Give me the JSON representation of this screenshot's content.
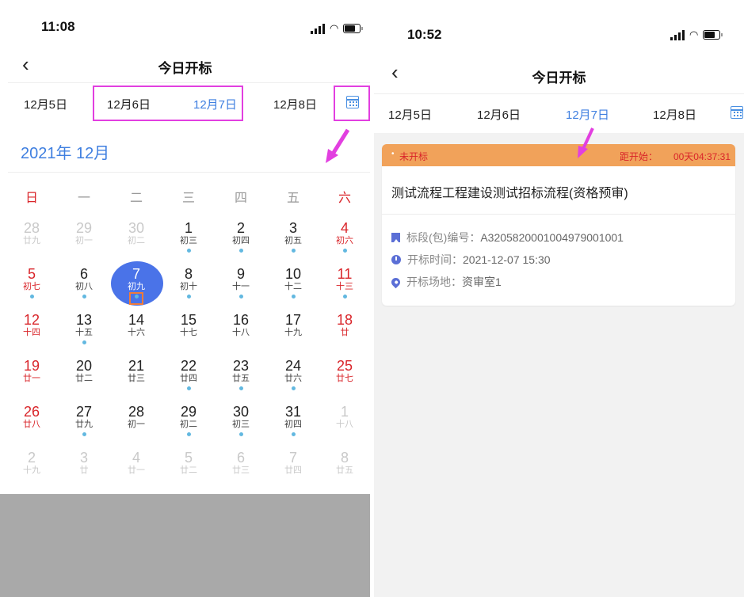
{
  "left": {
    "status_time": "11:08",
    "nav_title": "今日开标",
    "dates": [
      "12月5日",
      "12月6日",
      "12月7日",
      "12月8日"
    ],
    "month_title": "2021年 12月",
    "weekdays": [
      "日",
      "一",
      "二",
      "三",
      "四",
      "五",
      "六"
    ],
    "calendar": [
      [
        {
          "d": "28",
          "l": "廿九",
          "o": 1
        },
        {
          "d": "29",
          "l": "初一",
          "o": 1
        },
        {
          "d": "30",
          "l": "初二",
          "o": 1
        },
        {
          "d": "1",
          "l": "初三",
          "dot": 1
        },
        {
          "d": "2",
          "l": "初四",
          "dot": 1
        },
        {
          "d": "3",
          "l": "初五",
          "dot": 1
        },
        {
          "d": "4",
          "l": "初六",
          "dot": 1
        }
      ],
      [
        {
          "d": "5",
          "l": "初七",
          "dot": 1
        },
        {
          "d": "6",
          "l": "初八",
          "dot": 1
        },
        {
          "d": "7",
          "l": "初九",
          "dot": 1,
          "today": 1
        },
        {
          "d": "8",
          "l": "初十",
          "dot": 1
        },
        {
          "d": "9",
          "l": "十一",
          "dot": 1
        },
        {
          "d": "10",
          "l": "十二",
          "dot": 1
        },
        {
          "d": "11",
          "l": "十三",
          "dot": 1
        }
      ],
      [
        {
          "d": "12",
          "l": "十四"
        },
        {
          "d": "13",
          "l": "十五",
          "dot": 1
        },
        {
          "d": "14",
          "l": "十六"
        },
        {
          "d": "15",
          "l": "十七"
        },
        {
          "d": "16",
          "l": "十八"
        },
        {
          "d": "17",
          "l": "十九"
        },
        {
          "d": "18",
          "l": "廿"
        }
      ],
      [
        {
          "d": "19",
          "l": "廿一"
        },
        {
          "d": "20",
          "l": "廿二"
        },
        {
          "d": "21",
          "l": "廿三"
        },
        {
          "d": "22",
          "l": "廿四",
          "dot": 1
        },
        {
          "d": "23",
          "l": "廿五",
          "dot": 1
        },
        {
          "d": "24",
          "l": "廿六",
          "dot": 1
        },
        {
          "d": "25",
          "l": "廿七"
        }
      ],
      [
        {
          "d": "26",
          "l": "廿八"
        },
        {
          "d": "27",
          "l": "廿九",
          "dot": 1
        },
        {
          "d": "28",
          "l": "初一"
        },
        {
          "d": "29",
          "l": "初二",
          "dot": 1
        },
        {
          "d": "30",
          "l": "初三",
          "dot": 1
        },
        {
          "d": "31",
          "l": "初四",
          "dot": 1
        },
        {
          "d": "1",
          "l": "十八",
          "o": 1
        }
      ],
      [
        {
          "d": "2",
          "l": "十九",
          "o": 1
        },
        {
          "d": "3",
          "l": "廿",
          "o": 1
        },
        {
          "d": "4",
          "l": "廿一",
          "o": 1
        },
        {
          "d": "5",
          "l": "廿二",
          "o": 1
        },
        {
          "d": "6",
          "l": "廿三",
          "o": 1
        },
        {
          "d": "7",
          "l": "廿四",
          "o": 1
        },
        {
          "d": "8",
          "l": "廿五",
          "o": 1
        }
      ]
    ]
  },
  "right": {
    "status_time": "10:52",
    "nav_title": "今日开标",
    "dates": [
      "12月5日",
      "12月6日",
      "12月7日",
      "12月8日"
    ],
    "card": {
      "status": "未开标",
      "countdown_label": "距开始：",
      "countdown_value": "00天04:37:31",
      "title": "测试流程工程建设测试招标流程(资格预审)",
      "section_label": "标段(包)编号：",
      "section_value": "A3205820001004979001001",
      "time_label": "开标时间：",
      "time_value": "2021-12-07 15:30",
      "place_label": "开标场地：",
      "place_value": "资审室1"
    }
  },
  "colors": {
    "accent": "#3f7fe0",
    "highlight": "#e23fe0",
    "weekend": "#d9252a",
    "card_header": "#f1a25a",
    "selected": "#4a73e8"
  }
}
